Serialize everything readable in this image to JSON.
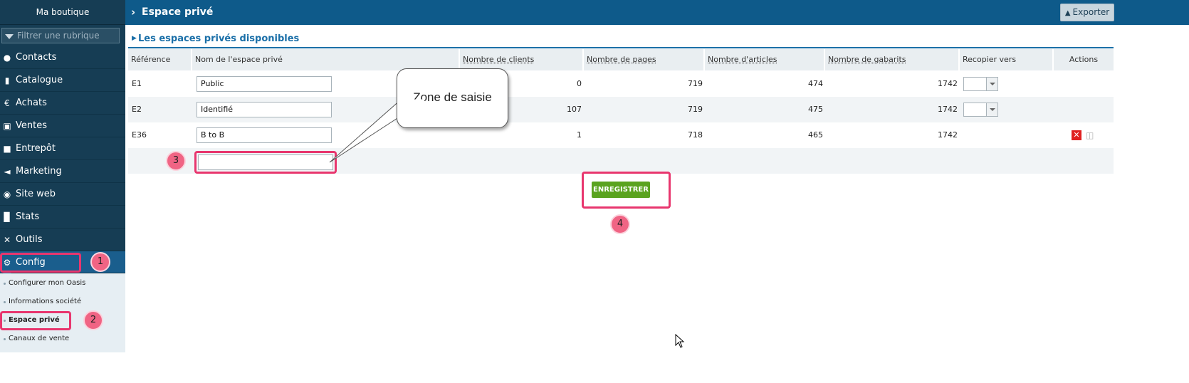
{
  "sidebar": {
    "shop_name": "Ma boutique",
    "filter_placeholder": "Filtrer une rubrique",
    "items": [
      {
        "label": "Contacts",
        "icon": "user-icon"
      },
      {
        "label": "Catalogue",
        "icon": "book-icon"
      },
      {
        "label": "Achats",
        "icon": "euro-icon"
      },
      {
        "label": "Ventes",
        "icon": "cart-icon"
      },
      {
        "label": "Entrepôt",
        "icon": "box-icon"
      },
      {
        "label": "Marketing",
        "icon": "megaphone-icon"
      },
      {
        "label": "Site web",
        "icon": "globe-icon"
      },
      {
        "label": "Stats",
        "icon": "bar-chart-icon"
      },
      {
        "label": "Outils",
        "icon": "wrench-icon"
      },
      {
        "label": "Config",
        "icon": "gear-icon",
        "active": true
      }
    ],
    "submenu": [
      {
        "label": "Configurer mon Oasis"
      },
      {
        "label": "Informations société"
      },
      {
        "label": "Espace privé",
        "active": true
      },
      {
        "label": "Canaux de vente"
      }
    ]
  },
  "header": {
    "title": "Espace privé",
    "export_label": "Exporter"
  },
  "section": {
    "title": "Les espaces privés disponibles"
  },
  "table": {
    "columns": [
      "Référence",
      "Nom de l'espace privé",
      "Nombre de clients",
      "Nombre de pages",
      "Nombre d'articles",
      "Nombre de gabarits",
      "Recopier vers",
      "Actions"
    ],
    "rows": [
      {
        "ref": "E1",
        "name": "Public",
        "clients": "0",
        "pages": "719",
        "articles": "474",
        "gabarits": "1742",
        "copy_dropdown": true,
        "delete": false
      },
      {
        "ref": "E2",
        "name": "Identifié",
        "clients": "107",
        "pages": "719",
        "articles": "475",
        "gabarits": "1742",
        "copy_dropdown": true,
        "delete": false
      },
      {
        "ref": "E36",
        "name": "B to B",
        "clients": "1",
        "pages": "718",
        "articles": "465",
        "gabarits": "1742",
        "copy_dropdown": false,
        "delete": true
      }
    ],
    "new_row_value": ""
  },
  "save_label": "ENREGISTRER",
  "annotations": {
    "callout_text": "Zone de saisie",
    "badges": [
      "1",
      "2",
      "3",
      "4"
    ],
    "highlight_color": "#e8366e"
  },
  "colors": {
    "sidebar_bg": "#163d54",
    "header_bg": "#0e5a8a",
    "accent": "#1a6fa8",
    "save_green": "#5aa31f",
    "delete_red": "#e02020"
  }
}
